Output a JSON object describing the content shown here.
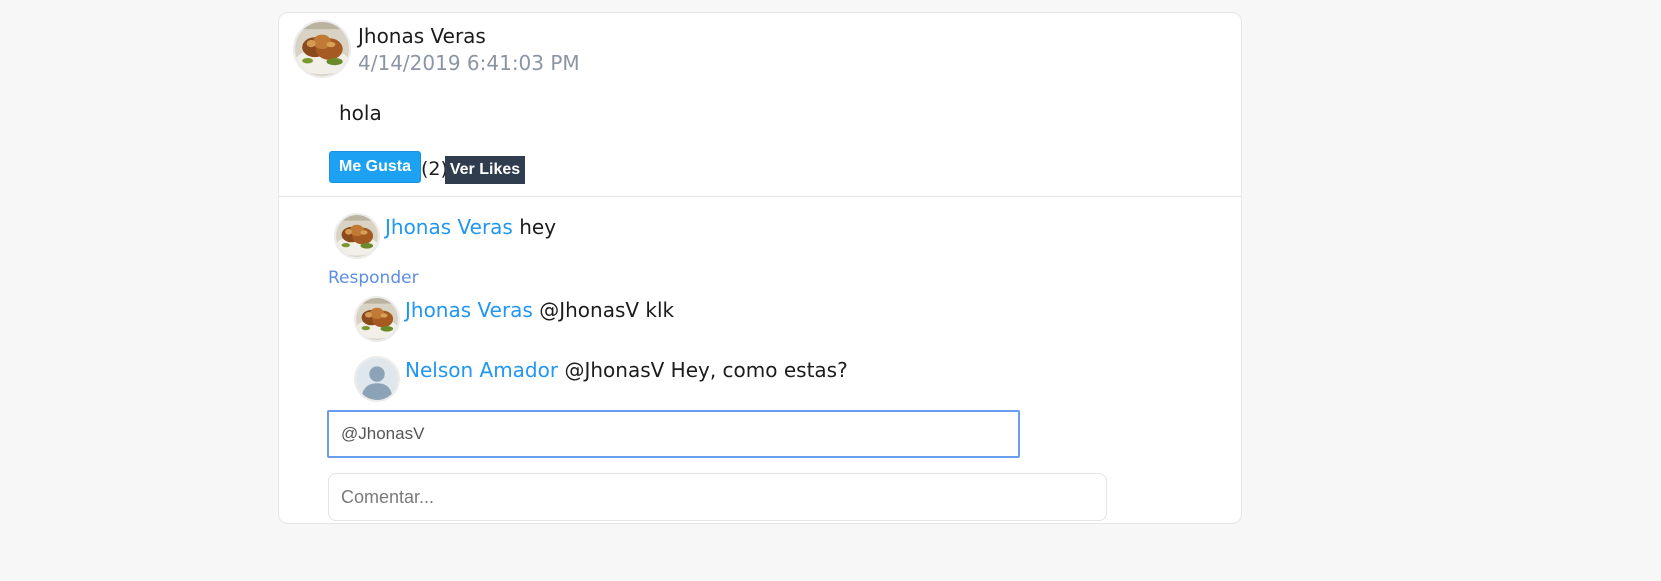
{
  "post": {
    "author": "Jhonas Veras",
    "date": "4/14/2019 6:41:03 PM",
    "body": "hola",
    "like_label": "Me Gusta",
    "like_count": "(2)",
    "view_likes_label": "Ver Likes"
  },
  "comment": {
    "author": "Jhonas Veras",
    "text": "hey",
    "reply_label": "Responder"
  },
  "replies": [
    {
      "author": "Jhonas Veras",
      "text": "@JhonasV klk",
      "avatar": "food-photo"
    },
    {
      "author": "Nelson Amador",
      "text": "@JhonasV Hey, como estas?",
      "avatar": "default-user"
    }
  ],
  "reply_input": {
    "value": "@JhonasV "
  },
  "comment_input": {
    "placeholder": "Comentar..."
  },
  "colors": {
    "accent": "#2196f3",
    "like_button": "#1da1f2",
    "view_likes_button": "#2f3d4e",
    "date_text": "#8b95a3",
    "reply_link": "#5b8ee6",
    "input_focus": "#6a9cf0"
  }
}
